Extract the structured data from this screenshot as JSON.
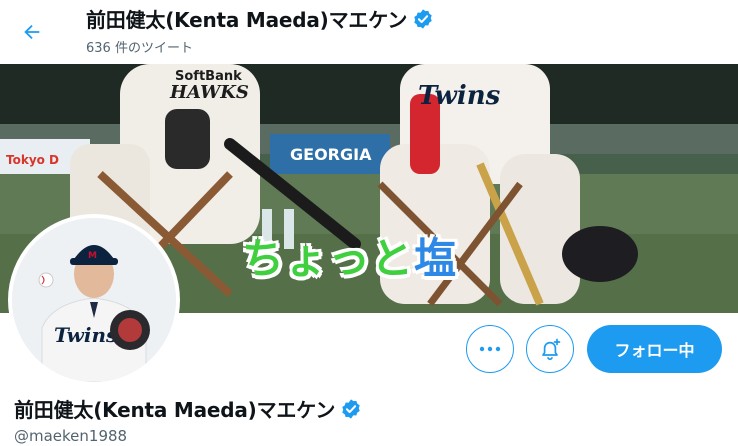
{
  "header": {
    "back_icon": "arrow-left-icon",
    "display_name": "前田健太(Kenta Maeda)マエケン",
    "tweet_count": "636 件のツイート"
  },
  "banner": {
    "sign_softbank": "SoftBank",
    "sign_hawks": "HAWKS",
    "sign_twins_left": "Twins",
    "sign_georgia": "GEORGIA",
    "sign_tokyo": "Tokyo D",
    "caption_part1": "ちょっと",
    "caption_part2": "塩"
  },
  "avatar": {
    "jersey_text": "Twins"
  },
  "actions": {
    "more_icon": "more-icon",
    "notify_icon": "bell-plus-icon",
    "follow_label": "フォロー中"
  },
  "profile": {
    "display_name": "前田健太(Kenta Maeda)マエケン",
    "handle": "@maeken1988"
  },
  "colors": {
    "accent": "#1d9bf0",
    "secondary_text": "#536471",
    "caption_green": "#3fcf3f",
    "caption_blue": "#2e88e6"
  }
}
